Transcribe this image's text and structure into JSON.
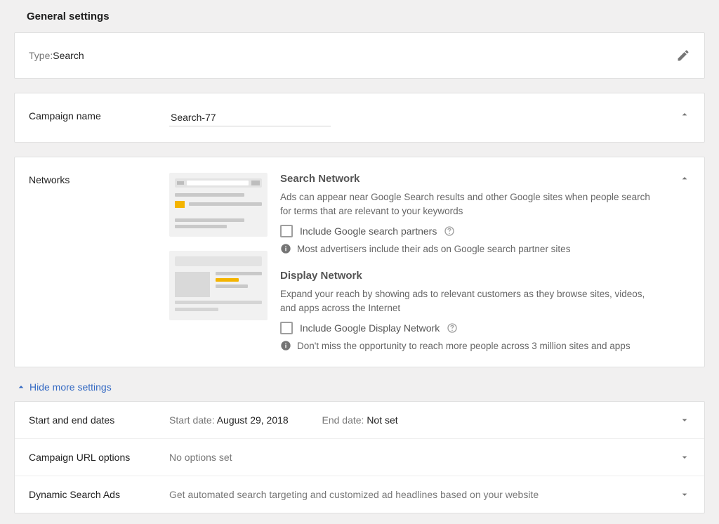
{
  "header": {
    "title": "General settings"
  },
  "type": {
    "label": "Type: ",
    "value": "Search"
  },
  "campaign": {
    "label": "Campaign name",
    "value": "Search-77"
  },
  "networks": {
    "label": "Networks",
    "search": {
      "title": "Search Network",
      "desc": "Ads can appear near Google Search results and other Google sites when people search for terms that are relevant to your keywords",
      "checkbox_label": "Include Google search partners",
      "info": "Most advertisers include their ads on Google search partner sites"
    },
    "display": {
      "title": "Display Network",
      "desc": "Expand your reach by showing ads to relevant customers as they browse sites, videos, and apps across the Internet",
      "checkbox_label": "Include Google Display Network",
      "info": "Don't miss the opportunity to reach more people across 3 million sites and apps"
    }
  },
  "hide_more": "Hide more settings",
  "rows": {
    "dates": {
      "label": "Start and end dates",
      "start_label": "Start date: ",
      "start_value": "August 29, 2018",
      "end_label": "End date: ",
      "end_value": "Not set"
    },
    "url": {
      "label": "Campaign URL options",
      "value": "No options set"
    },
    "dsa": {
      "label": "Dynamic Search Ads",
      "value": "Get automated search targeting and customized ad headlines based on your website"
    }
  }
}
